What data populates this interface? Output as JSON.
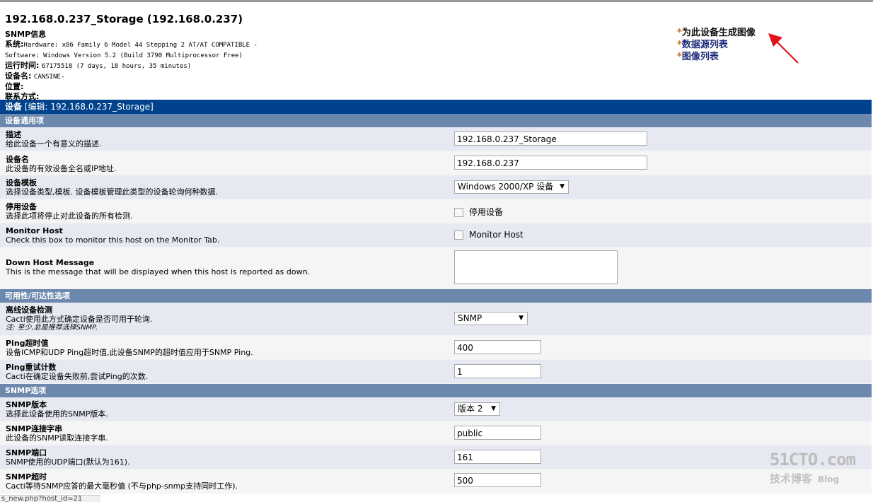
{
  "header": {
    "title": "192.168.0.237_Storage (192.168.0.237)",
    "snmp_info_label": "SNMP信息",
    "system_label": "系统:",
    "system_value_1": "Hardware: x86 Family 6 Model 44 Stepping 2 AT/AT COMPATIBLE -",
    "system_value_2": "Software: Windows Version 5.2 (Build 3790 Multiprocessor Free)",
    "uptime_label": "运行时间:",
    "uptime_value": "67175518 (7 days, 18 hours, 35 minutes)",
    "hostname_label": "设备名:",
    "hostname_value": "CANSINE-",
    "location_label": "位置:",
    "contact_label": "联系方式:"
  },
  "links": [
    {
      "label": "为此设备生成图像"
    },
    {
      "label": "数据源列表"
    },
    {
      "label": "图像列表"
    }
  ],
  "device_bar": {
    "prefix": "设备",
    "edit": "[编辑: 192.168.0.237_Storage]"
  },
  "sections": {
    "general": "设备通用项",
    "availability": "可用性/可达性选项",
    "snmp": "SNMP选项"
  },
  "fields": {
    "description": {
      "label": "描述",
      "desc": "给此设备一个有意义的描述.",
      "value": "192.168.0.237_Storage"
    },
    "hostname": {
      "label": "设备名",
      "desc": "此设备的有效设备全名或IP地址.",
      "value": "192.168.0.237"
    },
    "template": {
      "label": "设备模板",
      "desc": "选择设备类型,模板. 设备模板管理此类型的设备轮询何种数据.",
      "value": "Windows 2000/XP 设备"
    },
    "disable": {
      "label": "停用设备",
      "desc": "选择此项将停止对此设备的所有检测.",
      "check_label": "停用设备"
    },
    "monitor": {
      "label": "Monitor Host",
      "desc": "Check this box to monitor this host on the Monitor Tab.",
      "check_label": "Monitor Host"
    },
    "down_msg": {
      "label": "Down Host Message",
      "desc": "This is the message that will be displayed when this host is reported as down."
    },
    "detect": {
      "label": "离线设备检测",
      "desc": "Cacti使用此方式确定设备是否可用于轮询.",
      "note": "注: 至少,总是推荐选择SNMP.",
      "value": "SNMP"
    },
    "ping_timeout": {
      "label": "Ping超时值",
      "desc": "设备ICMP和UDP Ping超时值,此设备SNMP的超时值应用于SNMP Ping.",
      "value": "400"
    },
    "ping_retry": {
      "label": "Ping重试计数",
      "desc": "Cacti在确定设备失败前,尝试Ping的次数.",
      "value": "1"
    },
    "snmp_version": {
      "label": "SNMP版本",
      "desc": "选择此设备使用的SNMP版本.",
      "value": "版本 2"
    },
    "snmp_community": {
      "label": "SNMP连接字串",
      "desc": "此设备的SNMP读取连接字串.",
      "value": "public"
    },
    "snmp_port": {
      "label": "SNMP端口",
      "desc": "SNMP使用的UDP端口(默认为161).",
      "value": "161"
    },
    "snmp_timeout": {
      "label": "SNMP超时",
      "desc": "Cacti等待SNMP应答的最大毫秒值 (不与php-snmp支持同时工作).",
      "value": "500"
    }
  },
  "watermark": {
    "big": "51CTO.com",
    "small": "技术博客",
    "blog": "Blog"
  },
  "status_url": "s_new.php?host_id=21"
}
